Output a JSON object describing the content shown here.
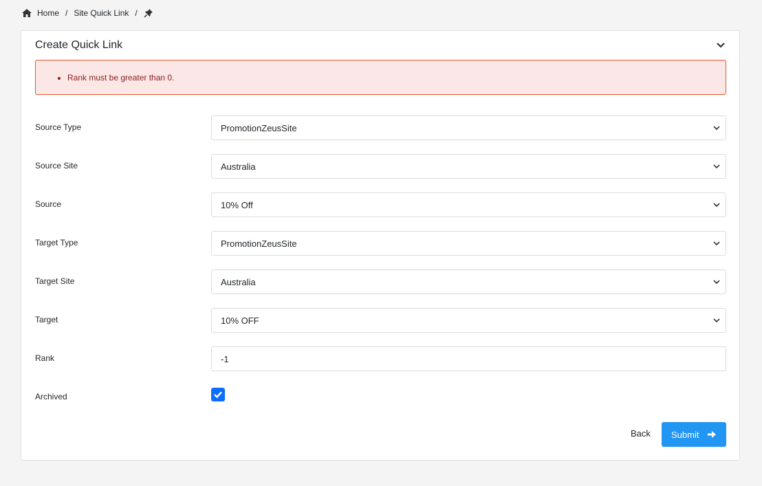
{
  "breadcrumb": {
    "home_icon": "home-icon",
    "items": [
      "Home",
      "Site Quick Link"
    ],
    "separator": "/",
    "current_icon": "pin-icon"
  },
  "card": {
    "title": "Create Quick Link",
    "collapse_icon": "chevron-down-icon"
  },
  "alert": {
    "errors": [
      "Rank must be greater than 0."
    ]
  },
  "form": {
    "fields": [
      {
        "label": "Source Type",
        "type": "select",
        "value": "PromotionZeusSite"
      },
      {
        "label": "Source Site",
        "type": "select",
        "value": "Australia"
      },
      {
        "label": "Source",
        "type": "select",
        "value": "10% Off"
      },
      {
        "label": "Target Type",
        "type": "select",
        "value": "PromotionZeusSite"
      },
      {
        "label": "Target Site",
        "type": "select",
        "value": "Australia"
      },
      {
        "label": "Target",
        "type": "select",
        "value": "10% OFF"
      },
      {
        "label": "Rank",
        "type": "text",
        "value": "-1"
      },
      {
        "label": "Archived",
        "type": "checkbox",
        "checked": true
      }
    ]
  },
  "actions": {
    "back_label": "Back",
    "submit_label": "Submit",
    "submit_icon": "arrow-right-icon"
  },
  "colors": {
    "primary": "#2196f3",
    "checkbox": "#0d6efd",
    "alert_bg": "#fbe7e6",
    "alert_border": "#e8562e",
    "alert_text": "#8a1d1b"
  }
}
